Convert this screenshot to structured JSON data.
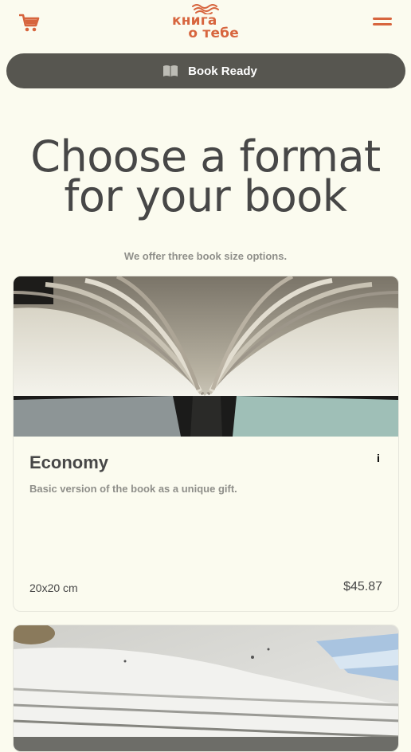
{
  "header": {
    "logo_line1": "книга",
    "logo_line2": "о тебе"
  },
  "ready_bar": {
    "label": "Book Ready"
  },
  "hero": {
    "title_line1": "Choose a format",
    "title_line2": "for your book",
    "subtitle": "We offer three book size options."
  },
  "cards": [
    {
      "title": "Economy",
      "description": "Basic version of the book as a unique gift.",
      "size": "20x20 cm",
      "price": "$45.87",
      "info": "i"
    }
  ],
  "colors": {
    "accent": "#d7653e",
    "bar": "#575650",
    "background": "#fbfbef",
    "text": "#474747",
    "muted": "#8f8f8a"
  },
  "icons": {
    "cart": "cart-icon",
    "menu": "menu-icon",
    "book": "book-icon",
    "info": "info-icon"
  }
}
